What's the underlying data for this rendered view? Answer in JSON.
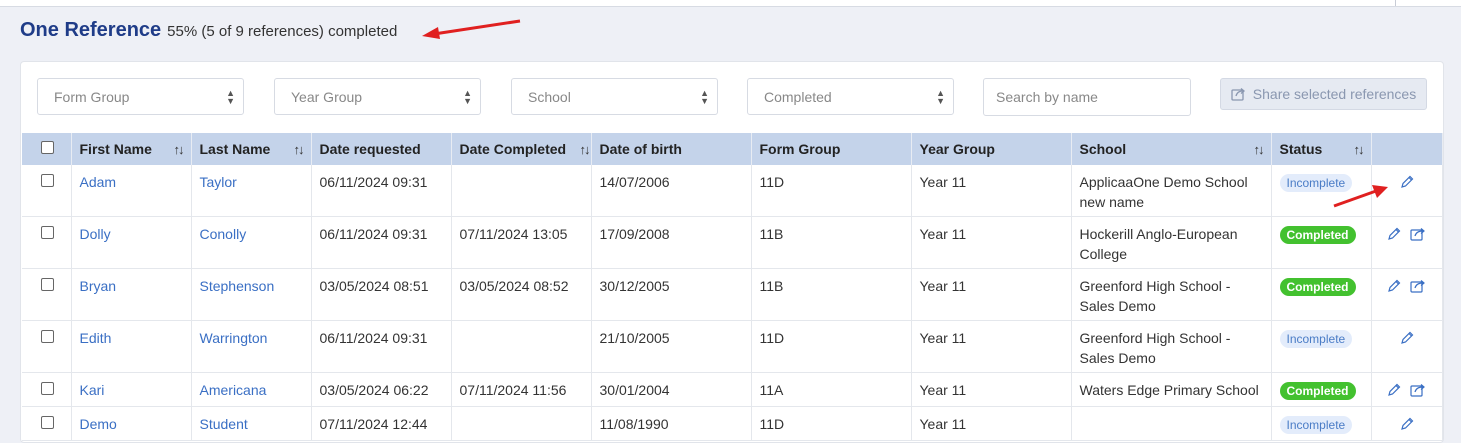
{
  "header": {
    "title": "One Reference",
    "progress": "55% (5 of 9 references) completed"
  },
  "filters": {
    "form_group": "Form Group",
    "year_group": "Year Group",
    "school": "School",
    "completed": "Completed",
    "search_placeholder": "Search by name",
    "share_label": "Share selected references"
  },
  "columns": {
    "first_name": "First Name",
    "last_name": "Last Name",
    "date_requested": "Date requested",
    "date_completed": "Date Completed",
    "date_of_birth": "Date of birth",
    "form_group": "Form Group",
    "year_group": "Year Group",
    "school": "School",
    "status": "Status"
  },
  "rows": [
    {
      "first_name": "Adam",
      "last_name": "Taylor",
      "date_requested": "06/11/2024 09:31",
      "date_completed": "",
      "dob": "14/07/2006",
      "form_group": "11D",
      "year_group": "Year 11",
      "school": "ApplicaaOne Demo School new name",
      "status": "Incomplete"
    },
    {
      "first_name": "Dolly",
      "last_name": "Conolly",
      "date_requested": "06/11/2024 09:31",
      "date_completed": "07/11/2024 13:05",
      "dob": "17/09/2008",
      "form_group": "11B",
      "year_group": "Year 11",
      "school": "Hockerill Anglo-European College",
      "status": "Completed"
    },
    {
      "first_name": "Bryan",
      "last_name": "Stephenson",
      "date_requested": "03/05/2024 08:51",
      "date_completed": "03/05/2024 08:52",
      "dob": "30/12/2005",
      "form_group": "11B",
      "year_group": "Year 11",
      "school": "Greenford High School - Sales Demo",
      "status": "Completed"
    },
    {
      "first_name": "Edith",
      "last_name": "Warrington",
      "date_requested": "06/11/2024 09:31",
      "date_completed": "",
      "dob": "21/10/2005",
      "form_group": "11D",
      "year_group": "Year 11",
      "school": "Greenford High School - Sales Demo",
      "status": "Incomplete"
    },
    {
      "first_name": "Kari",
      "last_name": "Americana",
      "date_requested": "03/05/2024 06:22",
      "date_completed": "07/11/2024 11:56",
      "dob": "30/01/2004",
      "form_group": "11A",
      "year_group": "Year 11",
      "school": "Waters Edge Primary School",
      "status": "Completed"
    },
    {
      "first_name": "Demo",
      "last_name": "Student",
      "date_requested": "07/11/2024 12:44",
      "date_completed": "",
      "dob": "11/08/1990",
      "form_group": "11D",
      "year_group": "Year 11",
      "school": "",
      "status": "Incomplete"
    }
  ],
  "colors": {
    "heading": "#1f3c88",
    "link": "#3a6fc4",
    "table_header": "#c4d3ea",
    "completed": "#43c12f",
    "annotation_arrow": "#e02020"
  }
}
